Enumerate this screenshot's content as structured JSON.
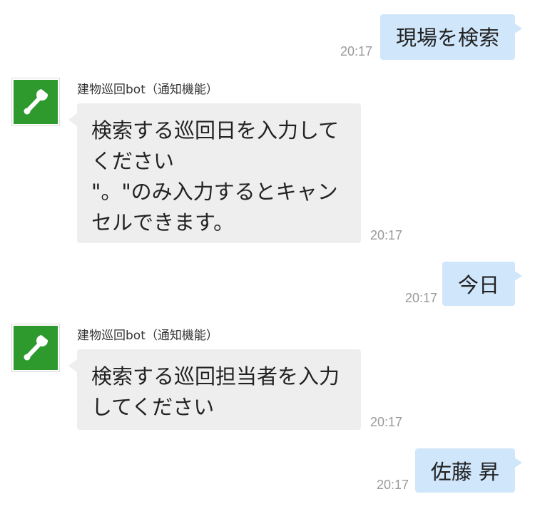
{
  "messages": [
    {
      "text": "現場を検索",
      "time": "20:17"
    },
    {
      "sender": "建物巡回bot（通知機能）",
      "avatar_icon": "wrench-icon",
      "text": "検索する巡回日を入力して\nください\n\"。\"のみ入力するとキャン\nセルできます。",
      "time": "20:17"
    },
    {
      "text": "今日",
      "time": "20:17"
    },
    {
      "sender": "建物巡回bot（通知機能）",
      "avatar_icon": "wrench-icon",
      "text": "検索する巡回担当者を入力\nしてください",
      "time": "20:17"
    },
    {
      "text": "佐藤 昇",
      "time": "20:17"
    }
  ],
  "colors": {
    "outgoing_bubble": "#cfe6fb",
    "incoming_bubble": "#eeeeee",
    "avatar_bg": "#2e9a2e",
    "timestamp": "#999999"
  }
}
